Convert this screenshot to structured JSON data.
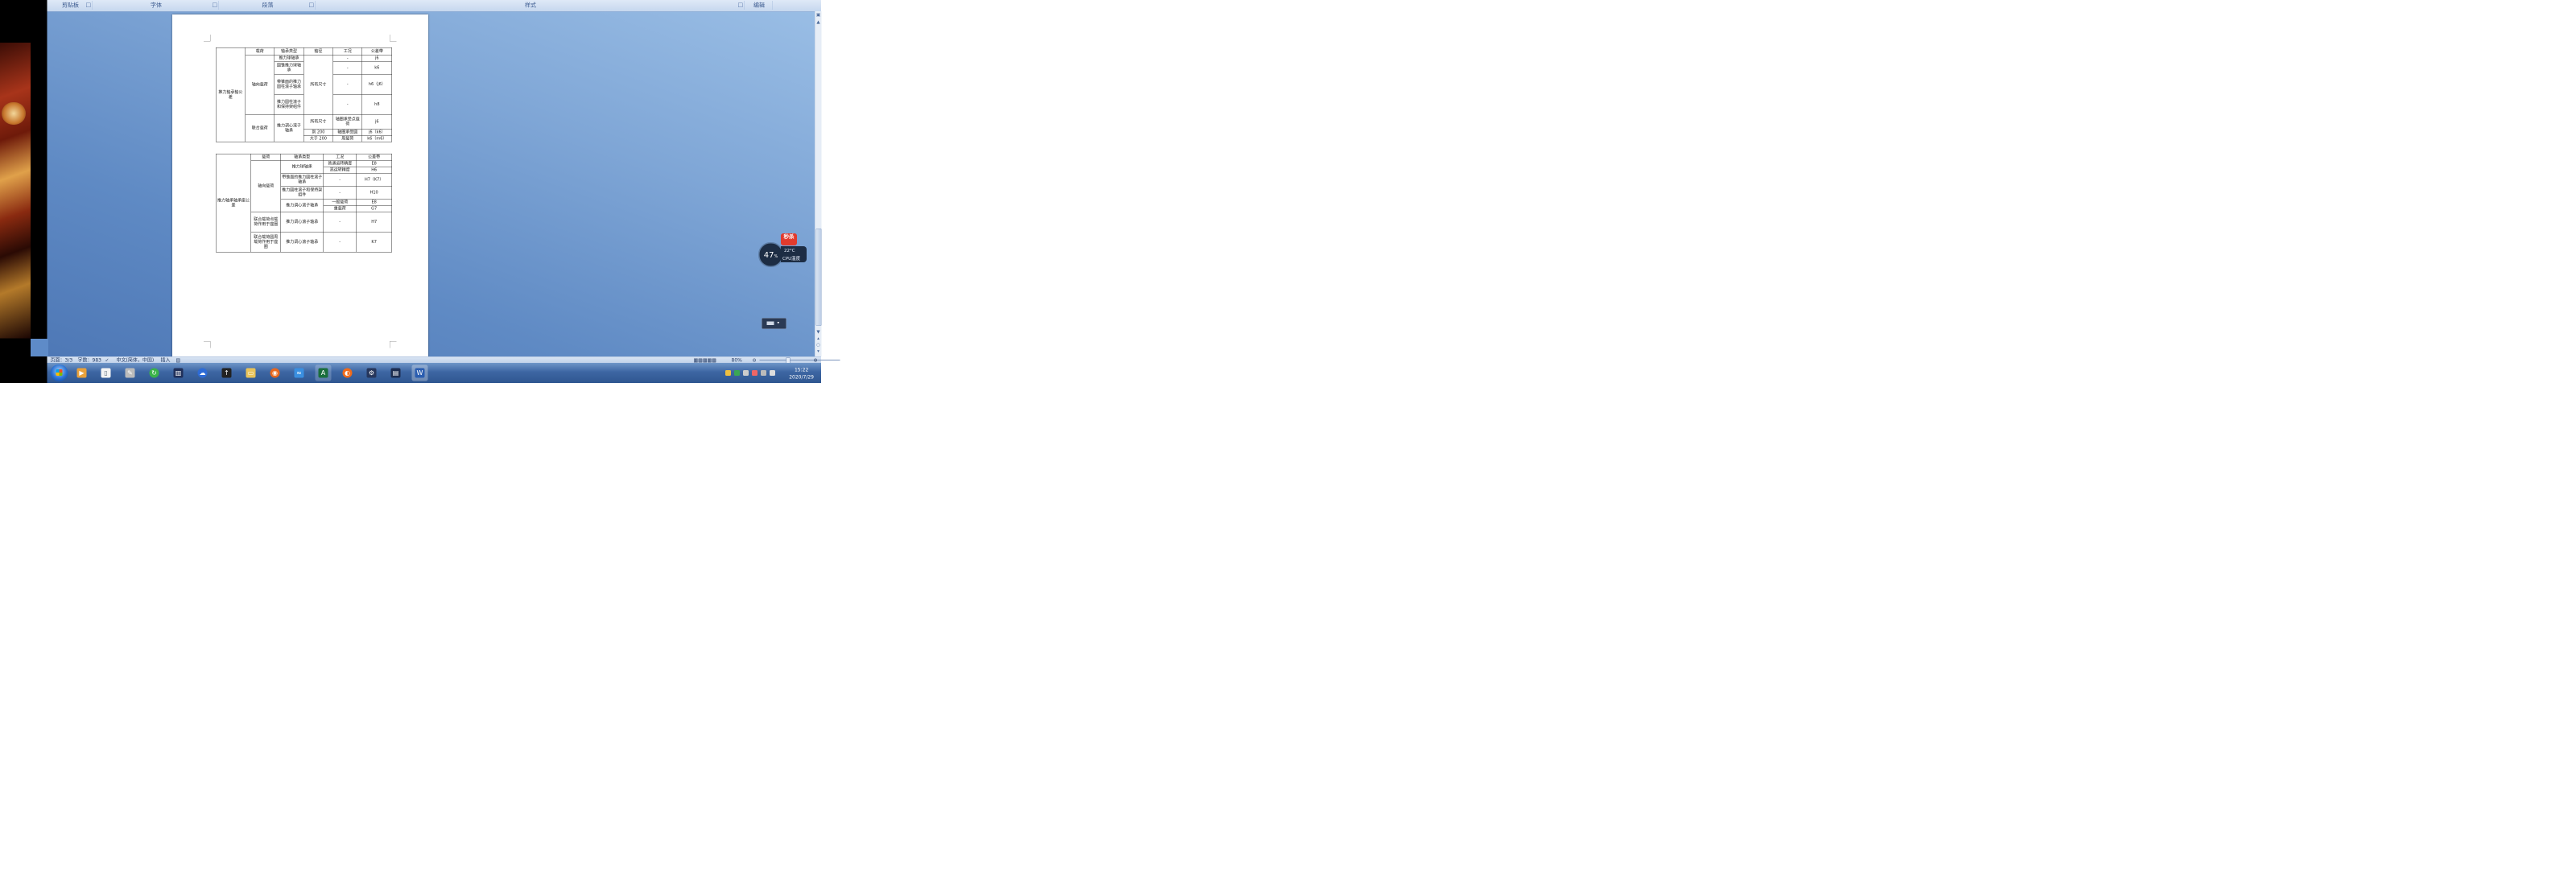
{
  "ribbon": {
    "groups": [
      "剪贴板",
      "字体",
      "段落",
      "样式",
      "编辑"
    ]
  },
  "table1": {
    "title": "推力轴承轴公差",
    "header": [
      "载荷",
      "轴承类型",
      "轴径",
      "工况",
      "公差带"
    ],
    "row_group_a": "轴向载荷",
    "row_group_b": "联合载荷",
    "rows": [
      [
        "推力球轴承",
        "-",
        "j6"
      ],
      [
        "圆锥推力球轴承",
        "-",
        "k6"
      ],
      [
        "带锥面的推力圆柱滚子轴承",
        "-",
        "h6（j6）"
      ],
      [
        "推力圆柱滚子和保持架组件",
        "-",
        "h8"
      ],
      [
        "推力调心滚子轴承"
      ]
    ],
    "all_sizes": "所有尺寸",
    "c_rows": [
      [
        "所有尺寸",
        "轴圈承受点载荷",
        "j6"
      ],
      [
        "到 200",
        "轴圈承受圆",
        "j6（k6）"
      ],
      [
        "大于 200",
        "周载荷",
        "k6（m6）"
      ]
    ]
  },
  "table2": {
    "title": "推力轴承轴承座公差",
    "header": [
      "载荷",
      "轴承类型",
      "工况",
      "公差带"
    ],
    "axial": "轴向载荷",
    "rows": [
      [
        "推力球轴承",
        "普通运转精度",
        "E8"
      ],
      [
        "",
        "高运转精度",
        "H6"
      ],
      [
        "带锥面的推力圆柱滚子轴承",
        "-",
        "H7（K7）"
      ],
      [
        "推力圆柱滚子和保持架组件",
        "-",
        "H10"
      ],
      [
        "推力调心滚子轴承",
        "一般载荷",
        "E8"
      ],
      [
        "",
        "重载荷",
        "G7"
      ]
    ],
    "combined_a": {
      "load": "联合载荷点载荷作用于座圈",
      "type": "推力调心滚子轴承",
      "cond": "-",
      "tol": "H7"
    },
    "combined_b": {
      "load": "联合载荷圆周载荷作用于座圈",
      "type": "推力调心滚子轴承",
      "cond": "-",
      "tol": "K7"
    }
  },
  "widget": {
    "cpu_percent": "47",
    "percent_sign": "%",
    "temp": "22°C",
    "cpu_label": "CPU温度",
    "badge": "秒杀"
  },
  "status": {
    "page": "页面：3/3",
    "words": "字数：983",
    "lang": "中文(简体，中国)",
    "mode": "插入",
    "zoom": "80%"
  },
  "taskbar": {
    "time": "15:22",
    "date": "2020/7/29"
  },
  "colors": {
    "desktop": "#6f98d0",
    "taskbar": "#3d66a3",
    "ribbon": "#d4e1f2"
  }
}
